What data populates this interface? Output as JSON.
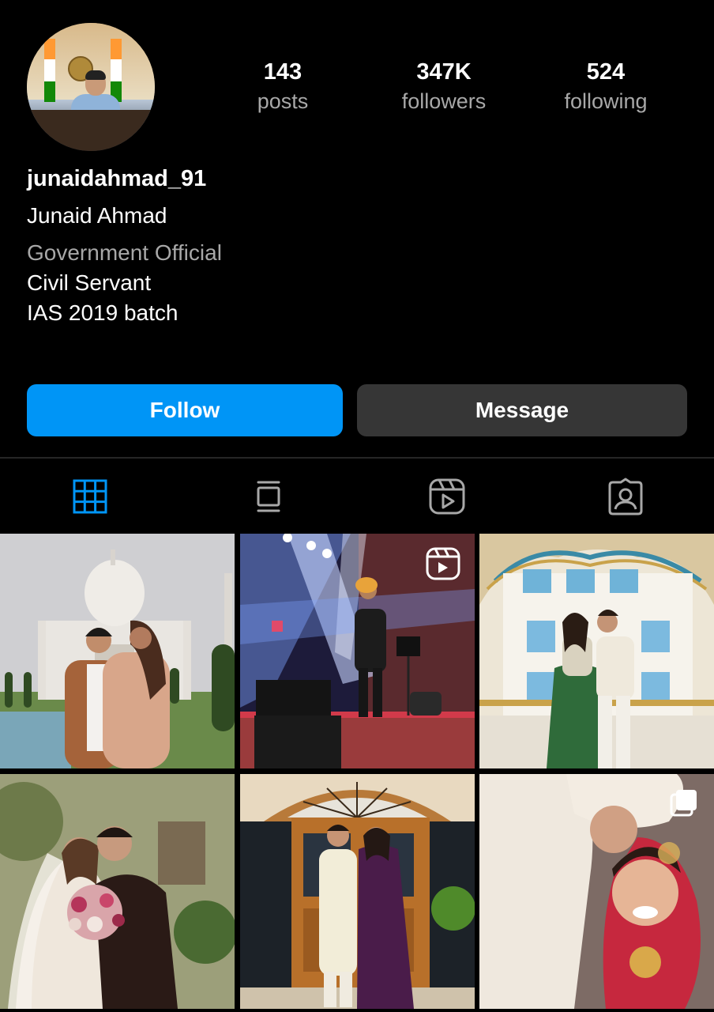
{
  "profile": {
    "username": "junaidahmad_91",
    "full_name": "Junaid Ahmad",
    "category": "Government Official",
    "bio_lines": [
      "Civil Servant",
      "IAS 2019 batch"
    ]
  },
  "stats": [
    {
      "value": "143",
      "label": "posts"
    },
    {
      "value": "347K",
      "label": "followers"
    },
    {
      "value": "524",
      "label": "following"
    }
  ],
  "actions": {
    "follow_label": "Follow",
    "message_label": "Message"
  },
  "tabs": [
    {
      "icon": "grid-icon",
      "active": true
    },
    {
      "icon": "feed-icon",
      "active": false
    },
    {
      "icon": "reels-icon",
      "active": false
    },
    {
      "icon": "tagged-icon",
      "active": false
    }
  ],
  "posts": [
    {
      "kind": "photo",
      "subject": "taj-mahal-couple"
    },
    {
      "kind": "reel",
      "subject": "concert-stage"
    },
    {
      "kind": "photo",
      "subject": "palace-couple"
    },
    {
      "kind": "photo",
      "subject": "wedding-bouquet"
    },
    {
      "kind": "photo",
      "subject": "door-couple"
    },
    {
      "kind": "carousel",
      "subject": "bride-groom"
    }
  ],
  "colors": {
    "background": "#000000",
    "primary_button": "#0095f6",
    "secondary_button": "#363636",
    "muted_text": "#a8a8a8",
    "active_tab": "#0095f6"
  }
}
